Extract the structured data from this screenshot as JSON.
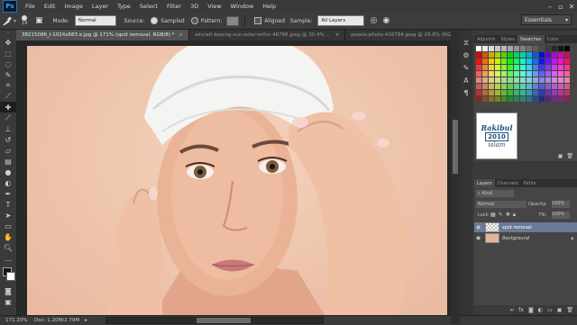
{
  "menu": {
    "logo": "Ps",
    "items": [
      "File",
      "Edit",
      "Image",
      "Layer",
      "Type",
      "Select",
      "Filter",
      "3D",
      "View",
      "Window",
      "Help"
    ],
    "window_controls": [
      "–",
      "▫",
      "✕"
    ]
  },
  "options_bar": {
    "brush_size": "19",
    "mode_label": "Mode:",
    "mode_value": "Normal",
    "source_label": "Source:",
    "sampled_label": "Sampled",
    "pattern_label": "Pattern:",
    "aligned_label": "Aligned",
    "sample_label": "Sample:",
    "sample_value": "All Layers",
    "workspace": "Essentials"
  },
  "tabs": [
    {
      "label": "38215086_l-1024x683 e.jpg @ 171% (spot removal, RGB/8) *",
      "active": true
    },
    {
      "label": "aircraft-boeing-sun-solar-ortho-46786.jpeg @ 30.4% ...",
      "active": false
    },
    {
      "label": "pexels-photo-416784.jpeg @ 29.8% (RGB/8...",
      "active": false
    }
  ],
  "status": {
    "zoom": "171.20%",
    "doc": "Doc: 1.20M/2.79M"
  },
  "panels": {
    "swatch_tabs": [
      "Adjustm",
      "Styles",
      "Swatches",
      "Color"
    ],
    "active_swatch_tab": "Swatches",
    "watermark_line1": "Rakibul",
    "watermark_line2": "2010",
    "watermark_line3": "islam",
    "layer_tabs": [
      "Layers",
      "Channels",
      "Paths"
    ],
    "kind_label": "Kind",
    "blend_mode": "Normal",
    "opacity_label": "Opacity:",
    "opacity_value": "100%",
    "lock_label": "Lock:",
    "fill_label": "Fill:",
    "fill_value": "100%",
    "layers": [
      {
        "name": "spot removal",
        "selected": true
      },
      {
        "name": "Background",
        "selected": false
      }
    ]
  }
}
